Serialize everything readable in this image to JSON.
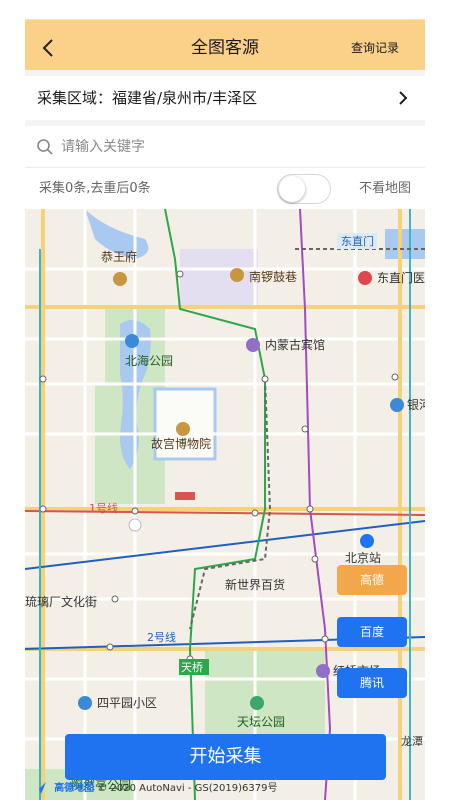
{
  "header": {
    "title": "全图客源",
    "history_label": "查询记录"
  },
  "region": {
    "label": "采集区域：福建省/泉州市/丰泽区"
  },
  "search": {
    "placeholder": "请输入关键字"
  },
  "stats": {
    "count_text": "采集0条,去重后0条",
    "toggle_on": false,
    "no_map_label": "不看地图"
  },
  "map": {
    "labels": {
      "gongwangfu": "恭王府",
      "nanluoguxiang": "南锣鼓巷",
      "dongzhimen_station": "东直门",
      "dongzhimen_hospital": "东直门医",
      "beihai": "北海公园",
      "neimenggu_hotel": "内蒙古宾馆",
      "gugong": "故宫博物院",
      "bank": "银河",
      "line1": "1号线",
      "beijing_station": "北京站",
      "xinshijie": "新世界百货",
      "liulichang": "琉璃厂文化街",
      "line2": "2号线",
      "tianqiao": "天桥",
      "siping": "四平园小区",
      "tiantan": "天坛公园",
      "longtan": "龙潭",
      "taoranting": "陶然亭公园",
      "hongqiao": "红桥市场"
    },
    "attribution_logo": "高德地图",
    "attribution_text": "© 2020 AutoNavi - GS(2019)6379号"
  },
  "providers": {
    "gaode": "高德",
    "baidu": "百度",
    "tengxun": "腾讯"
  },
  "start_button": "开始采集",
  "colors": {
    "header_bg": "#fbd089",
    "primary_blue": "#1f73f1",
    "gaode_orange": "#f4a64a"
  }
}
